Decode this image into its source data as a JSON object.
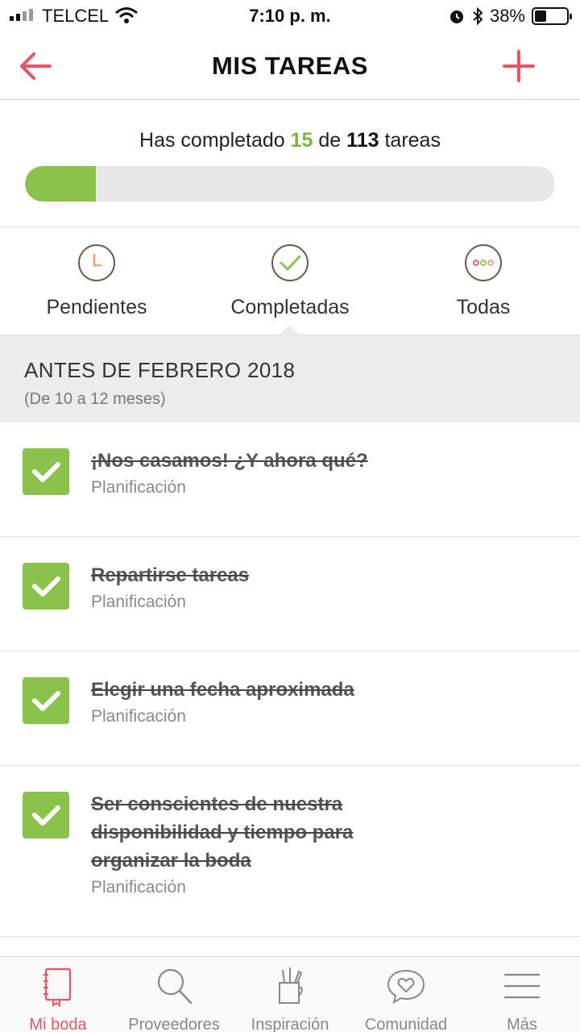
{
  "status_bar": {
    "carrier": "TELCEL",
    "time": "7:10 p. m.",
    "battery": "38%"
  },
  "header": {
    "title": "MIS TAREAS"
  },
  "progress": {
    "prefix": "Has completado",
    "completed": "15",
    "connector": "de",
    "total": "113",
    "suffix": "tareas",
    "fraction": 0.133
  },
  "filters": [
    {
      "label": "Pendientes",
      "icon": "clock-icon"
    },
    {
      "label": "Completadas",
      "icon": "check-circle-icon"
    },
    {
      "label": "Todas",
      "icon": "dots-circle-icon"
    }
  ],
  "section": {
    "title": "ANTES DE FEBRERO 2018",
    "subtitle": "(De 10 a 12 meses)"
  },
  "tasks": [
    {
      "name": "¡Nos casamos! ¿Y ahora qué?",
      "category": "Planificación",
      "done": true
    },
    {
      "name": "Repartirse tareas",
      "category": "Planificación",
      "done": true
    },
    {
      "name": "Elegir una fecha aproximada",
      "category": "Planificación",
      "done": true
    },
    {
      "name": "Ser conscientes de nuestra disponibilidad y tiempo para organizar la boda",
      "category": "Planificación",
      "done": true
    }
  ],
  "tabs": [
    {
      "label": "Mi boda",
      "icon": "notebook-icon",
      "active": true
    },
    {
      "label": "Proveedores",
      "icon": "search-icon",
      "active": false
    },
    {
      "label": "Inspiración",
      "icon": "craft-cup-icon",
      "active": false
    },
    {
      "label": "Comunidad",
      "icon": "chat-heart-icon",
      "active": false
    },
    {
      "label": "Más",
      "icon": "menu-icon",
      "active": false
    }
  ],
  "colors": {
    "accent": "#e8555e",
    "success": "#8bc34a",
    "section_bg": "#ececec"
  }
}
